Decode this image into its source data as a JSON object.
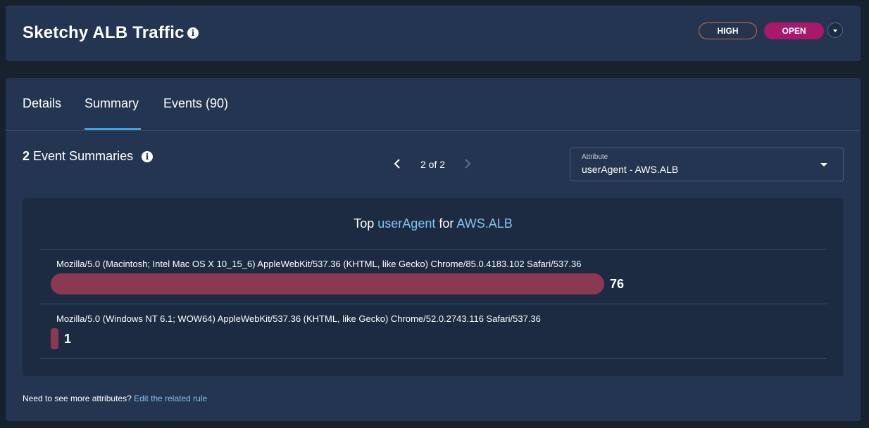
{
  "header": {
    "title": "Sketchy ALB Traffic",
    "severity": "HIGH",
    "status": "OPEN",
    "info_icon": "info-icon",
    "status_menu_icon": "chevron-down-icon"
  },
  "tabs": [
    {
      "label": "Details",
      "active": false
    },
    {
      "label": "Summary",
      "active": true
    },
    {
      "label": "Events (90)",
      "active": false
    }
  ],
  "summary": {
    "count": "2",
    "label": "Event Summaries",
    "pager": {
      "text": "2 of 2",
      "prev_icon": "chevron-left-icon",
      "next_icon": "chevron-right-icon"
    }
  },
  "attribute_select": {
    "label": "Attribute",
    "value": "userAgent - AWS.ALB"
  },
  "chart_title": {
    "prefix": "Top",
    "attribute": "userAgent",
    "connector": "for",
    "source": "AWS.ALB"
  },
  "chart_data": {
    "type": "bar",
    "title": "Top userAgent for AWS.ALB",
    "categories": [
      "Mozilla/5.0 (Macintosh; Intel Mac OS X 10_15_6) AppleWebKit/537.36 (KHTML, like Gecko) Chrome/85.0.4183.102 Safari/537.36",
      "Mozilla/5.0 (Windows NT 6.1; WOW64) AppleWebKit/537.36 (KHTML, like Gecko) Chrome/52.0.2743.116 Safari/537.36"
    ],
    "values": [
      76,
      1
    ]
  },
  "footer": {
    "note": "Need to see more attributes?",
    "link": "Edit the related rule"
  },
  "colors": {
    "background": "#18212e",
    "card": "#233550",
    "accent": "#3da3e2",
    "bar": "#8b3952",
    "severity_border": "#e0683f",
    "status_bg": "#a8196c"
  }
}
